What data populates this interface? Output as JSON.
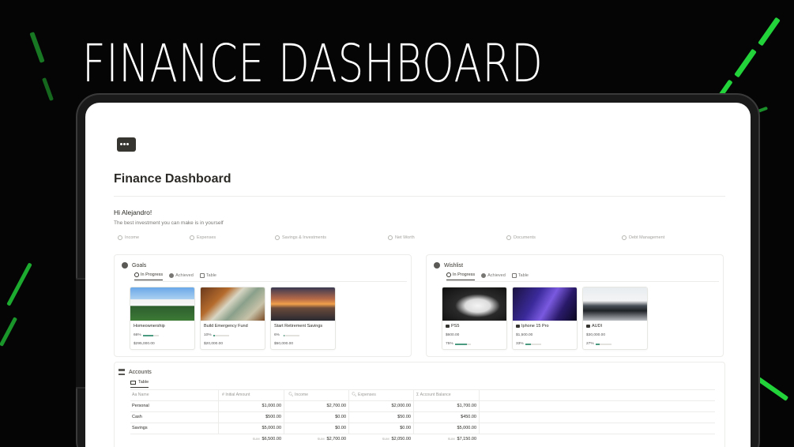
{
  "promo": {
    "title": "FINANCE DASHBOARD"
  },
  "colors": {
    "accent_green": "#22d33a",
    "progress": "#4a9b7f",
    "background": "#050505"
  },
  "page": {
    "title": "Finance Dashboard",
    "greeting": "Hi Alejandro!",
    "quote": "The best investment you can make is in yourself"
  },
  "nav": [
    {
      "label": "Income",
      "icon": "income-icon"
    },
    {
      "label": "Expenses",
      "icon": "expenses-icon"
    },
    {
      "label": "Savings & Investments",
      "icon": "savings-icon"
    },
    {
      "label": "Net Worth",
      "icon": "net-worth-icon"
    },
    {
      "label": "Documents",
      "icon": "documents-icon"
    },
    {
      "label": "Debt Management",
      "icon": "debt-icon"
    }
  ],
  "goals": {
    "title": "Goals",
    "views": [
      "In Progress",
      "Achieved",
      "Table"
    ],
    "items": [
      {
        "name": "Homeownership",
        "pct": "66%",
        "progress": 0.66,
        "amount": "$295,000.00",
        "image": "house"
      },
      {
        "name": "Build Emergency Fund",
        "pct": "10%",
        "progress": 0.1,
        "amount": "$20,000.00",
        "image": "money"
      },
      {
        "name": "Start Retirement Savings",
        "pct": "6%",
        "progress": 0.06,
        "amount": "$50,000.00",
        "image": "sunset"
      }
    ]
  },
  "wishlist": {
    "title": "Wishlist",
    "views": [
      "In Progress",
      "Achieved",
      "Table"
    ],
    "items": [
      {
        "name": "PS5",
        "amount": "$600.00",
        "pct": "75%",
        "progress": 0.75,
        "image": "controller"
      },
      {
        "name": "Iphone 15 Pro",
        "amount": "$1,500.00",
        "pct": "33%",
        "progress": 0.33,
        "image": "phone"
      },
      {
        "name": "AUDI",
        "amount": "$30,000.00",
        "pct": "27%",
        "progress": 0.27,
        "image": "car"
      }
    ]
  },
  "accounts": {
    "title": "Accounts",
    "tab": "Table",
    "columns": [
      "Aa Name",
      "# Initial Amount",
      "Income",
      "Expenses",
      "Account Balance"
    ],
    "rows": [
      [
        "Personal",
        "$1,000.00",
        "$2,700.00",
        "$2,000.00",
        "$1,700.00"
      ],
      [
        "Cash",
        "$500.00",
        "$0.00",
        "$50.00",
        "$450.00"
      ],
      [
        "Savings",
        "$5,000.00",
        "$0.00",
        "$0.00",
        "$5,000.00"
      ]
    ],
    "sum_label": "SUM",
    "sums": [
      "$6,500.00",
      "$2,700.00",
      "$2,050.00",
      "$7,150.00"
    ]
  }
}
